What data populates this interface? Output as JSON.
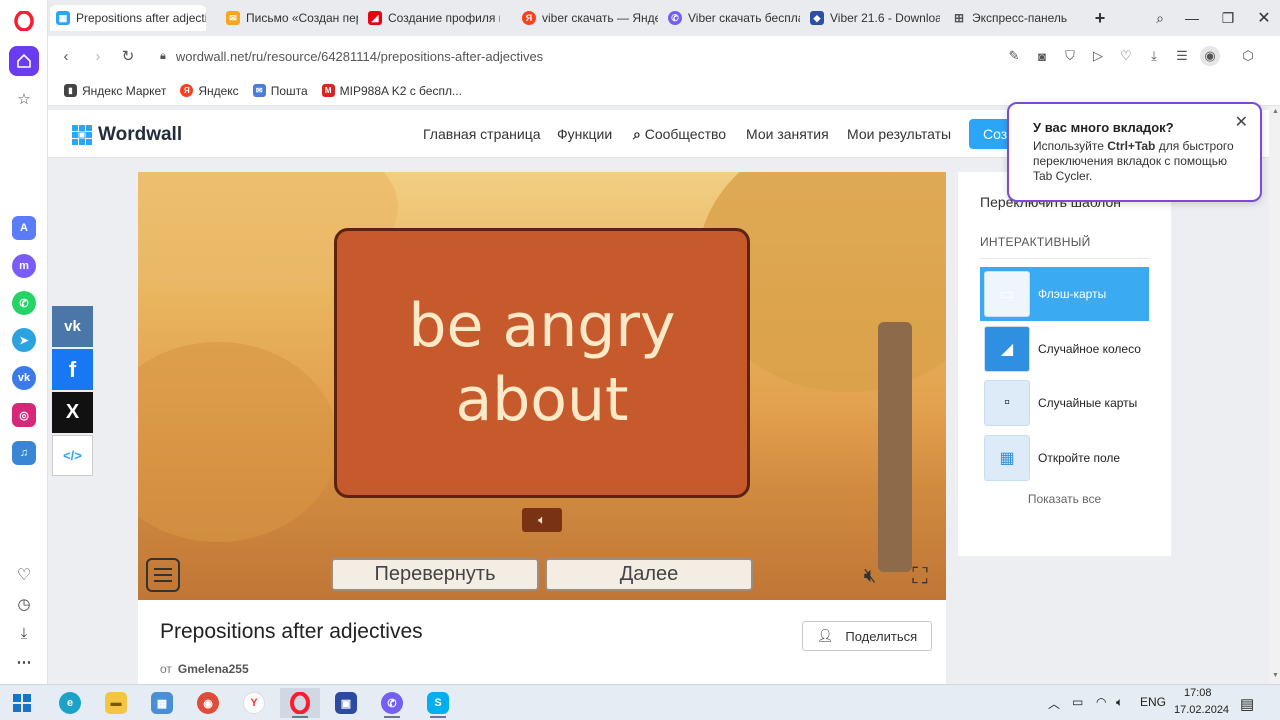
{
  "tabs": [
    {
      "label": "Prepositions after adjectiv",
      "favicon": "wordwall-icon",
      "active": true
    },
    {
      "label": "Письмо «Создан перс",
      "favicon": "mail-icon"
    },
    {
      "label": "Создание профиля и",
      "favicon": "mts-icon"
    },
    {
      "label": "viber скачать — Янде",
      "favicon": "yandex-icon"
    },
    {
      "label": "Viber скачать беспла",
      "favicon": "viber-icon"
    },
    {
      "label": "Viber 21.6 - Downloa",
      "favicon": "shield-icon"
    },
    {
      "label": "Экспресс-панель",
      "favicon": "grid-icon"
    }
  ],
  "address_bar": {
    "url": "wordwall.net/ru/resource/64281114/prepositions-after-adjectives"
  },
  "bookmarks": [
    {
      "label": "Яндекс Маркет"
    },
    {
      "label": "Яндекс"
    },
    {
      "label": "Пошта"
    },
    {
      "label": "MIP988A K2 с беспл..."
    }
  ],
  "site": {
    "logo": "Wordwall",
    "nav": [
      "Главная страница",
      "Функции",
      "Сообщество",
      "Мои занятия",
      "Мои результаты"
    ],
    "create_label": "Соз"
  },
  "game": {
    "card_text": "be angry about",
    "flip_label": "Перевернуть",
    "next_label": "Далее"
  },
  "activity": {
    "title": "Prepositions after adjectives",
    "share_label": "Поделиться",
    "author_prefix": "от",
    "author": "Gmelena255"
  },
  "templates": {
    "header": "Переключить шаблон",
    "section": "ИНТЕРАКТИВНЫЙ",
    "items": [
      {
        "label": "Флэш-карты",
        "active": true
      },
      {
        "label": "Случайное колесо"
      },
      {
        "label": "Случайные карты"
      },
      {
        "label": "Откройте поле"
      }
    ],
    "show_all": "Показать все"
  },
  "popup": {
    "title": "У вас много вкладок?",
    "text_pre": "Используйте ",
    "shortcut": "Ctrl+Tab",
    "text_post": " для быстрого переключения вкладок с помощью Tab Cycler."
  },
  "taskbar": {
    "lang": "ENG",
    "time": "17:08",
    "date": "17.02.2024"
  },
  "colors": {
    "accent": "#2ba5f5",
    "card": "#c65a2c",
    "opera": "#ff1b2d",
    "popup_border": "#7b4bd7"
  }
}
